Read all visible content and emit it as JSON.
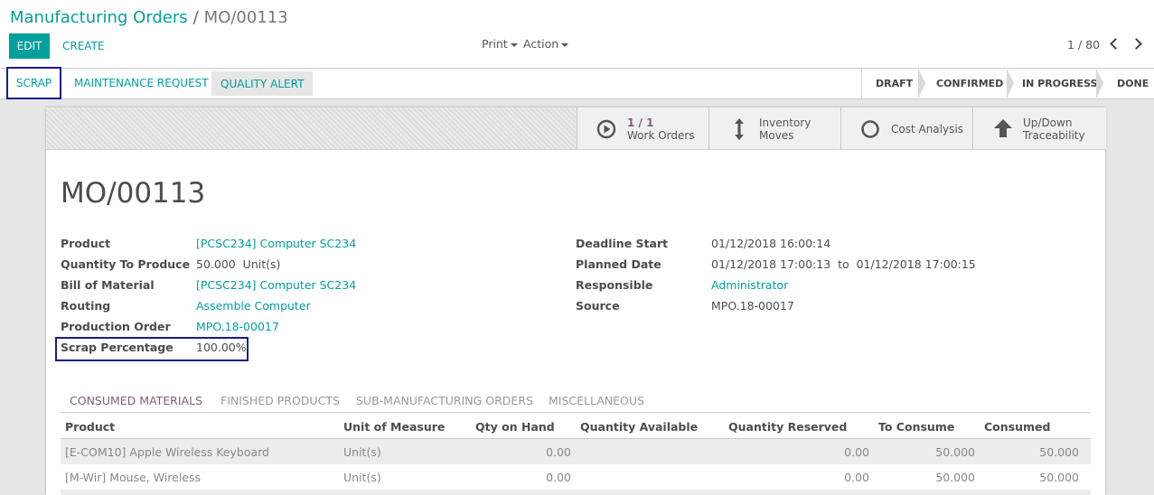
{
  "breadcrumb": {
    "parent": "Manufacturing Orders",
    "separator": "/",
    "current": "MO/00113"
  },
  "toolbar": {
    "edit": "EDIT",
    "create": "CREATE",
    "print": "Print",
    "action": "Action"
  },
  "pager": {
    "value": "1 / 80"
  },
  "statusbar": {
    "buttons": [
      "SCRAP",
      "MAINTENANCE REQUEST",
      "QUALITY ALERT"
    ],
    "states": [
      "DRAFT",
      "CONFIRMED",
      "IN PROGRESS",
      "DONE"
    ],
    "active_state": "IN PROGRESS"
  },
  "smart_buttons": [
    {
      "icon": "play-circle-icon",
      "value": "1 / 1",
      "label": "Work Orders"
    },
    {
      "icon": "arrows-vertical-icon",
      "line1": "Inventory",
      "line2": "Moves"
    },
    {
      "icon": "circle-icon",
      "label": "Cost Analysis"
    },
    {
      "icon": "arrow-up-icon",
      "line1": "Up/Down",
      "line2": "Traceability"
    }
  ],
  "record": {
    "name": "MO/00113",
    "left_fields": [
      {
        "label": "Product",
        "value": "[PCSC234] Computer SC234",
        "link": true
      },
      {
        "label": "Quantity To Produce",
        "value": "50.000  Unit(s)",
        "link": false
      },
      {
        "label": "Bill of Material",
        "value": "[PCSC234] Computer SC234",
        "link": true
      },
      {
        "label": "Routing",
        "value": "Assemble Computer",
        "link": true
      },
      {
        "label": "Production Order",
        "value": "MPO.18-00017",
        "link": true
      },
      {
        "label": "Scrap Percentage",
        "value": "100.00%",
        "link": false
      }
    ],
    "right_fields": [
      {
        "label": "Deadline Start",
        "value": "01/12/2018 16:00:14",
        "link": false
      },
      {
        "label": "Planned Date",
        "value": "01/12/2018 17:00:13  to  01/12/2018 17:00:15",
        "link": false
      },
      {
        "label": "Responsible",
        "value": "Administrator",
        "link": true
      },
      {
        "label": "Source",
        "value": "MPO.18-00017",
        "link": false
      }
    ]
  },
  "tabs": [
    "CONSUMED MATERIALS",
    "FINISHED PRODUCTS",
    "SUB-MANUFACTURING ORDERS",
    "MISCELLANEOUS"
  ],
  "table": {
    "columns": [
      "Product",
      "Unit of Measure",
      "Qty on Hand",
      "Quantity Available",
      "Quantity Reserved",
      "To Consume",
      "Consumed"
    ],
    "rows": [
      [
        "[E-COM10] Apple Wireless Keyboard",
        "Unit(s)",
        "0.00",
        "",
        "0.00",
        "50.000",
        "50.000"
      ],
      [
        "[M-Wir] Mouse, Wireless",
        "Unit(s)",
        "0.00",
        "",
        "0.00",
        "50.000",
        "50.000"
      ]
    ]
  },
  "colors": {
    "accent": "#00a09d",
    "brand": "#875a7b",
    "highlight_box": "#1a1a8a"
  }
}
